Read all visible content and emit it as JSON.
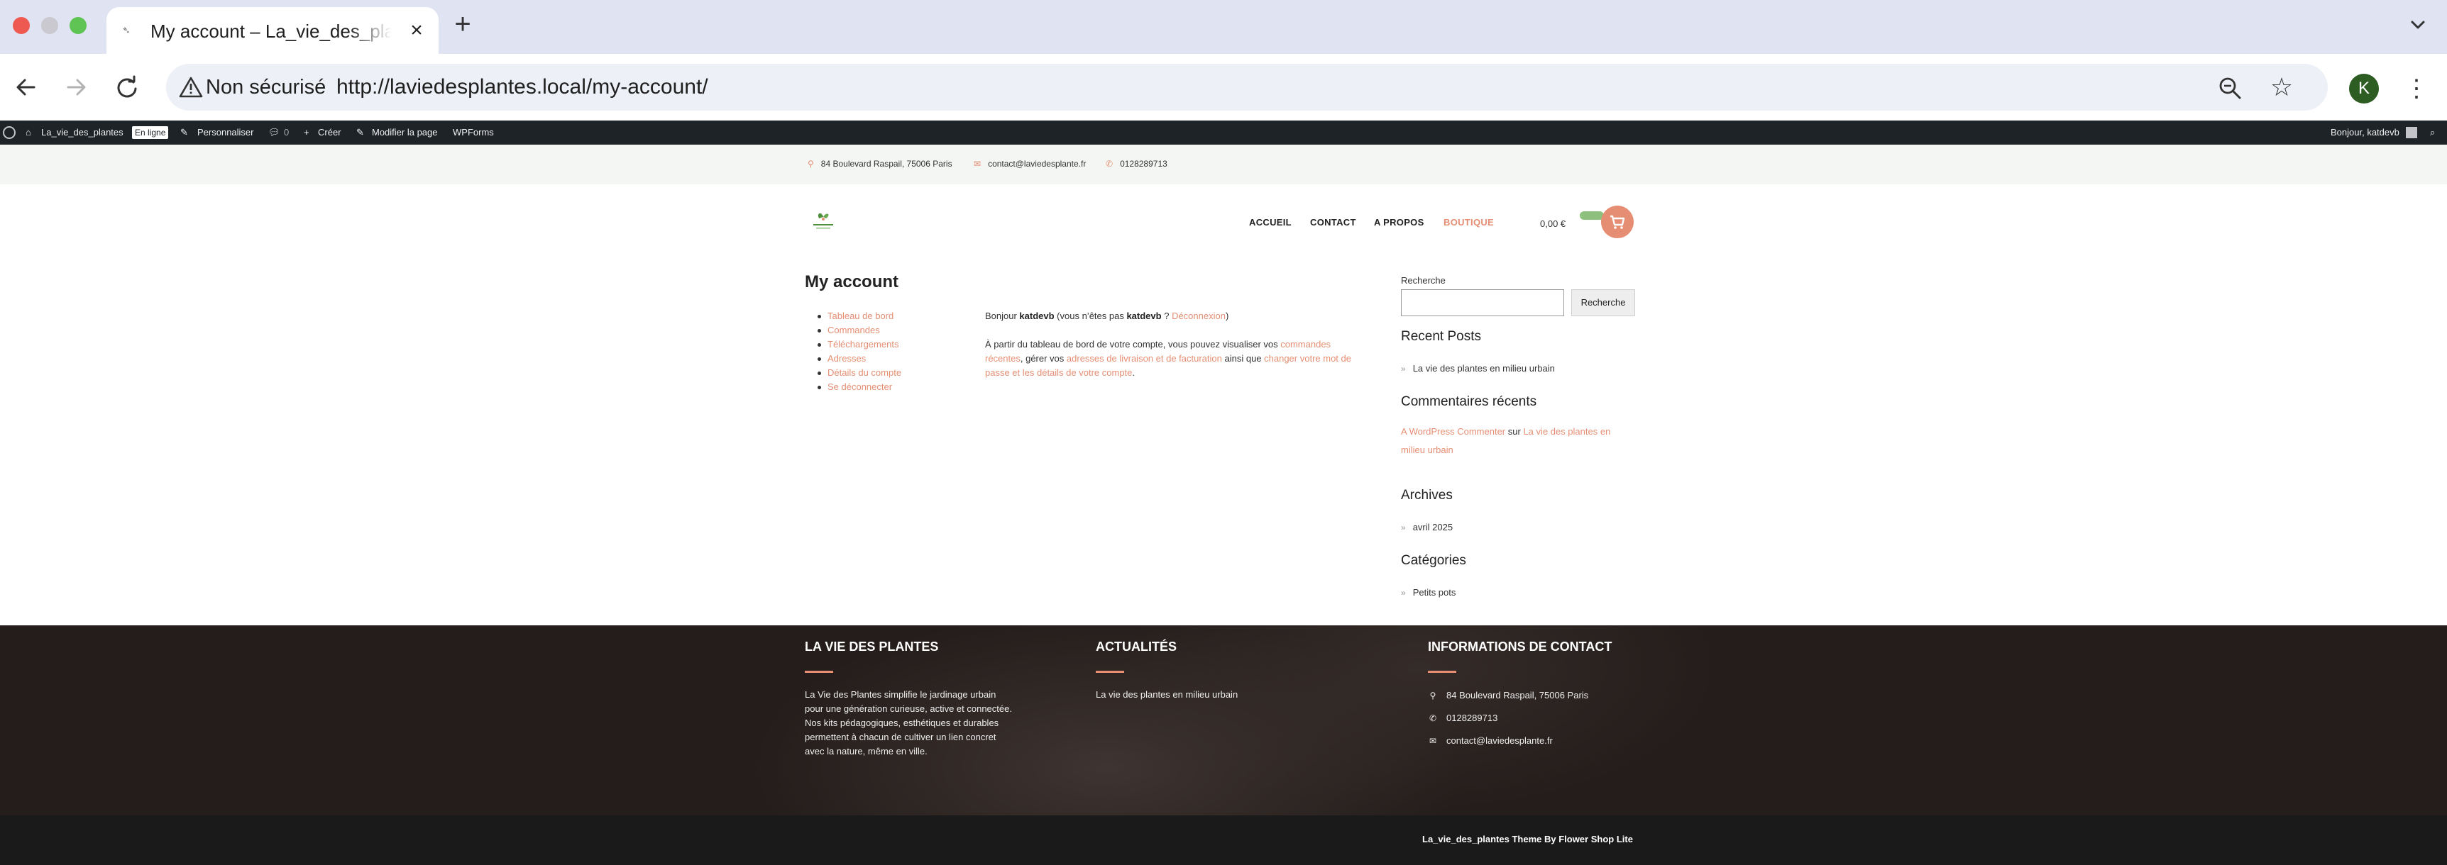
{
  "browser": {
    "tab_title": "My account – La_vie_des_plantes",
    "security_label": "Non sécurisé",
    "url_prefix": "http://laviedesplantes.local",
    "url_path": "/my-account/",
    "avatar_initial": "K",
    "icons": [
      "close-icon",
      "minimize-icon",
      "maximize-icon",
      "new-tab-icon",
      "back-icon",
      "forward-icon",
      "reload-icon",
      "warning-icon",
      "zoom-icon",
      "bookmark-star-icon",
      "kebab-menu-icon",
      "tab-list-chevron-icon"
    ]
  },
  "adminbar": {
    "site_name": "La_vie_des_plantes",
    "status_badge": "En ligne",
    "customize": "Personnaliser",
    "comments_count": "0",
    "create": "Créer",
    "edit_page": "Modifier la page",
    "wpforms": "WPForms",
    "greeting": "Bonjour, katdevb"
  },
  "topinfo": {
    "address": "84 Boulevard Raspail, 75006 Paris",
    "email": "contact@laviedesplante.fr",
    "phone": "0128289713"
  },
  "header": {
    "menu": [
      {
        "label": "ACCUEIL"
      },
      {
        "label": "CONTACT"
      },
      {
        "label": "A PROPOS"
      },
      {
        "label": "BOUTIQUE"
      }
    ],
    "cart_total": "0,00 €",
    "accent_color": "#e58e73",
    "secondary_color": "#8cc07c"
  },
  "account": {
    "title": "My account",
    "nav": [
      {
        "label": "Tableau de bord"
      },
      {
        "label": "Commandes"
      },
      {
        "label": "Téléchargements"
      },
      {
        "label": "Adresses"
      },
      {
        "label": "Détails du compte"
      },
      {
        "label": "Se déconnecter"
      }
    ],
    "hello_prefix": "Bonjour ",
    "username": "katdevb",
    "hello_mid": " (vous n’êtes pas ",
    "username2": "katdevb",
    "hello_q": " ? ",
    "logout_link": "Déconnexion",
    "hello_end": ")",
    "dash_text1": "À partir du tableau de bord de votre compte, vous pouvez visualiser vos ",
    "dash_link1": "commandes récentes",
    "dash_text2": ", gérer vos ",
    "dash_link2": "adresses de livraison et de facturation",
    "dash_text3": " ainsi que ",
    "dash_link3": "changer votre mot de passe et les détails de votre compte",
    "dash_text4": "."
  },
  "sidebar": {
    "search_label": "Recherche",
    "search_button": "Recherche",
    "recent_posts_title": "Recent Posts",
    "recent_post": "La vie des plantes en milieu urbain",
    "recent_comments_title": "Commentaires récents",
    "comment_author": "A WordPress Commenter",
    "comment_on": " sur ",
    "comment_post": "La vie des plantes en milieu urbain",
    "archives_title": "Archives",
    "archive_item": "avril 2025",
    "categories_title": "Catégories",
    "category_item": "Petits pots"
  },
  "footer": {
    "col1_title": "LA VIE DES PLANTES",
    "col1_text": "La Vie des Plantes simplifie le jardinage urbain pour une génération curieuse, active et connectée. Nos kits pédagogiques, esthétiques et durables permettent à chacun de cultiver un lien concret avec la nature, même en ville.",
    "col2_title": "ACTUALITÉS",
    "col2_item": "La vie des plantes en milieu urbain",
    "col3_title": "INFORMATIONS DE CONTACT",
    "address": "84 Boulevard Raspail, 75006 Paris",
    "phone": "0128289713",
    "email": "contact@laviedesplante.fr",
    "credits": "La_vie_des_plantes Theme By Flower Shop Lite"
  }
}
